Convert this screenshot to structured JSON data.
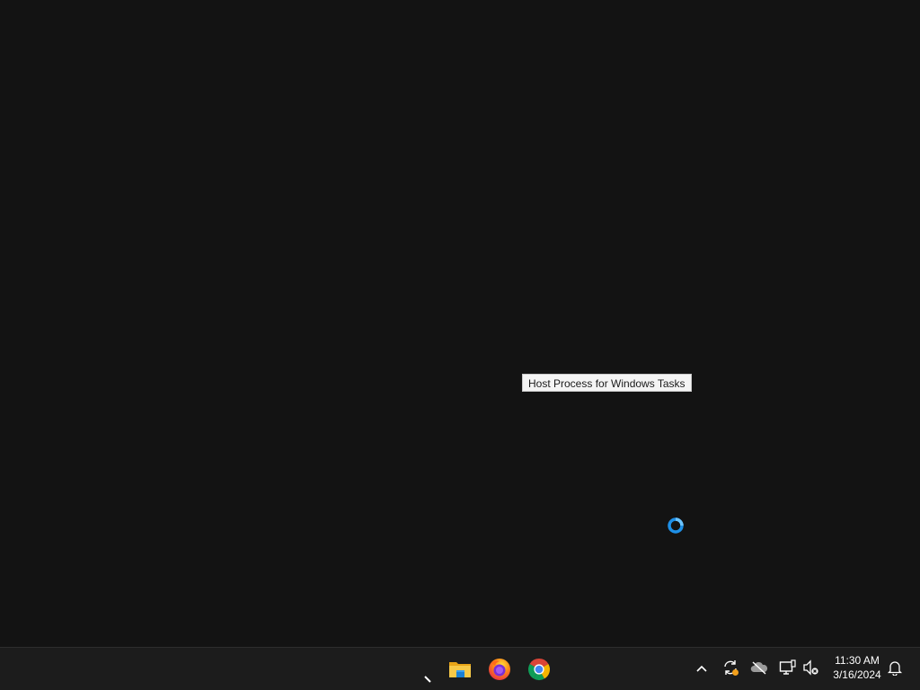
{
  "tooltip": {
    "text": "Host Process for Windows Tasks"
  },
  "taskbar": {
    "apps": [
      {
        "name": "File Explorer",
        "icon": "folder-icon"
      },
      {
        "name": "Firefox",
        "icon": "firefox-icon"
      },
      {
        "name": "Google Chrome",
        "icon": "chrome-icon"
      }
    ],
    "tray": {
      "icons": [
        "chevron-up-icon",
        "sync-icon",
        "cloud-offline-icon",
        "network-icon",
        "volume-muted-icon",
        "notification-bell-icon"
      ],
      "time": "11:30 AM",
      "date": "3/16/2024"
    }
  },
  "colors": {
    "desktop": "#131313",
    "taskbar": "#1c1c1c",
    "busy_cursor": "#1e90e8"
  }
}
